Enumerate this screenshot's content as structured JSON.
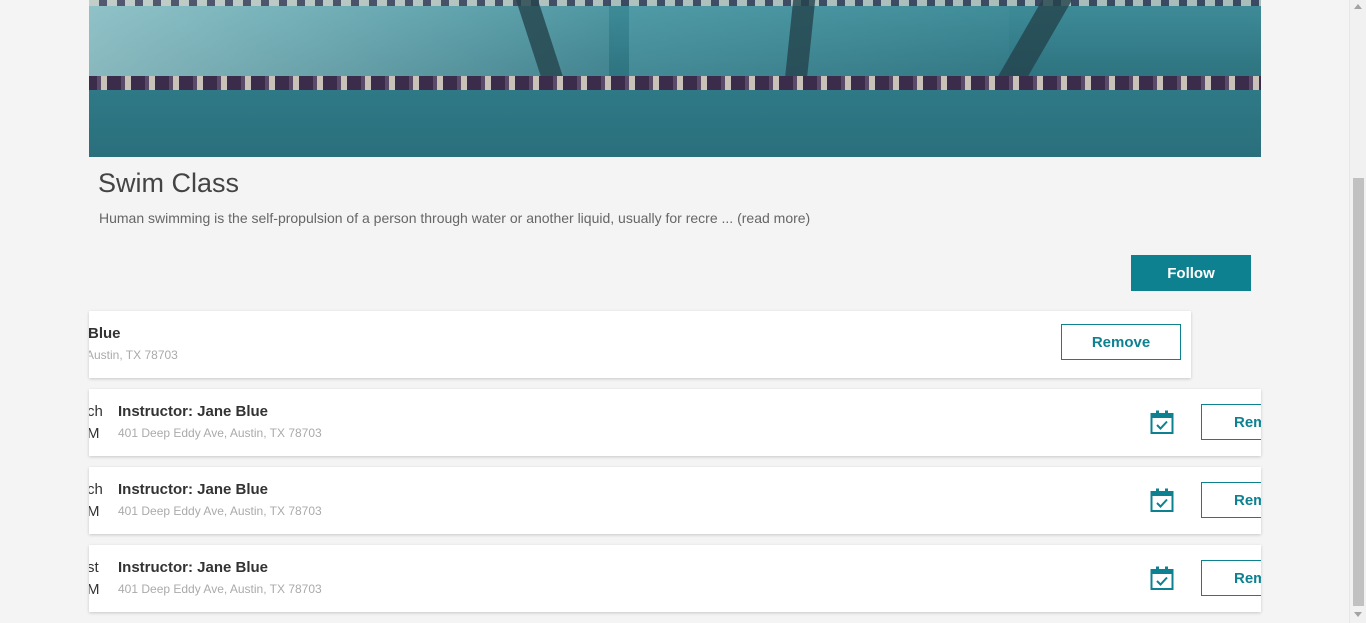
{
  "program": {
    "title": "Swim Class",
    "description": "Human swimming is the self-propulsion of a person through water or another liquid, usually for recre",
    "read_more": " ... (read more)",
    "follow_label": "Follow"
  },
  "instructor_card": {
    "name": "Blue",
    "address": "Austin, TX 78703",
    "remove_label": "Remove"
  },
  "sessions": [
    {
      "side_top": "ch",
      "side_bottom": "M",
      "name": "Instructor: Jane Blue",
      "address": "401 Deep Eddy Ave, Austin, TX 78703",
      "remove_label": "Rem",
      "icon": "calendar-check-icon"
    },
    {
      "side_top": "ch",
      "side_bottom": "M",
      "name": "Instructor: Jane Blue",
      "address": "401 Deep Eddy Ave, Austin, TX 78703",
      "remove_label": "Rem",
      "icon": "calendar-check-icon"
    },
    {
      "side_top": "st",
      "side_bottom": "M",
      "name": "Instructor: Jane Blue",
      "address": "401 Deep Eddy Ave, Austin, TX 78703",
      "remove_label": "Rem",
      "icon": "calendar-check-icon"
    }
  ],
  "colors": {
    "accent": "#0e8190",
    "background": "#f4f4f4"
  }
}
